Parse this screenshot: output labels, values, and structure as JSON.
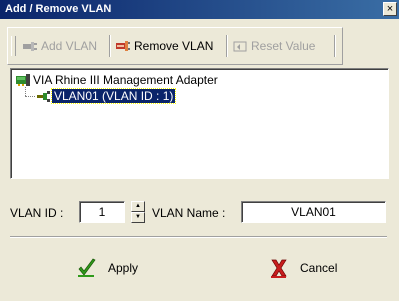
{
  "window": {
    "title": "Add / Remove VLAN",
    "close_glyph": "×"
  },
  "toolbar": {
    "add_vlan": {
      "label": "Add VLAN",
      "icon": "network-plug-icon",
      "enabled": false
    },
    "remove_vlan": {
      "label": "Remove VLAN",
      "icon": "network-remove-icon",
      "enabled": true
    },
    "reset_value": {
      "label": "Reset Value",
      "icon": "reset-icon",
      "enabled": false
    }
  },
  "tree": {
    "adapter": {
      "label": "VIA Rhine III Management Adapter",
      "icon": "network-adapter-icon"
    },
    "vlan": {
      "label": "VLAN01 (VLAN ID : 1)",
      "icon": "vlan-connector-icon",
      "selected": true
    }
  },
  "form": {
    "vlan_id_label": "VLAN ID :",
    "vlan_id_value": "1",
    "vlan_name_label": "VLAN Name :",
    "vlan_name_value": "VLAN01"
  },
  "buttons": {
    "apply": {
      "label": "Apply",
      "icon": "checkmark-icon"
    },
    "cancel": {
      "label": "Cancel",
      "icon": "cross-icon"
    }
  }
}
